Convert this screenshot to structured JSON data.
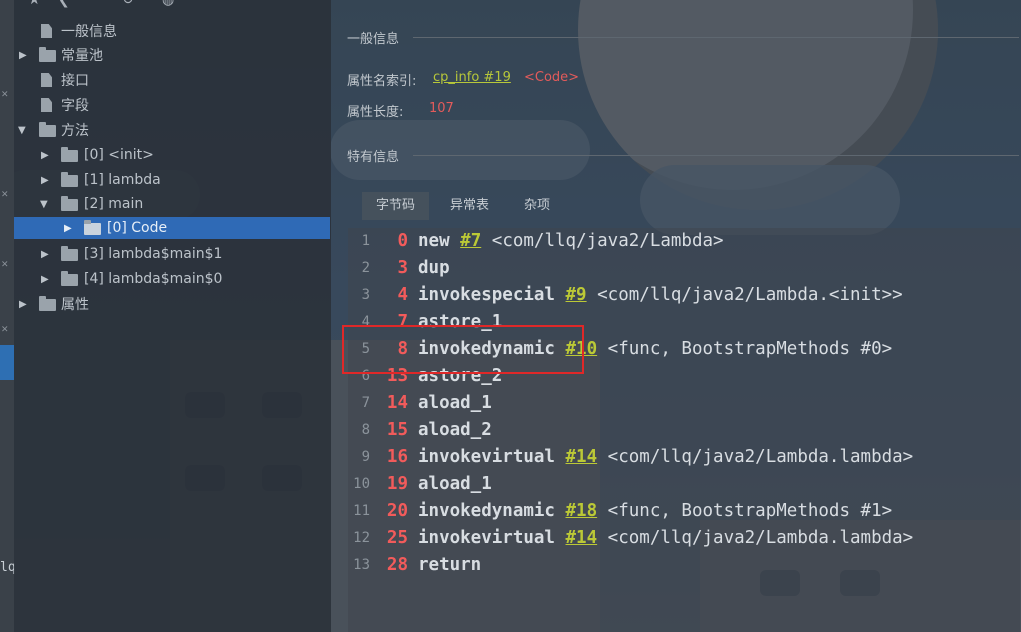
{
  "toolbar": {
    "icons": [
      "star-icon",
      "back-icon",
      "refresh-icon",
      "globe-icon"
    ]
  },
  "tree": {
    "items": [
      {
        "label": "一般信息",
        "icon": "file-icon",
        "arrow": ""
      },
      {
        "label": "常量池",
        "icon": "folder-icon",
        "arrow": "▶"
      },
      {
        "label": "接口",
        "icon": "file-icon",
        "arrow": ""
      },
      {
        "label": "字段",
        "icon": "file-icon",
        "arrow": ""
      },
      {
        "label": "方法",
        "icon": "folder-icon",
        "arrow": "▼"
      },
      {
        "label": "[0] <init>",
        "icon": "folder-icon",
        "arrow": "▶"
      },
      {
        "label": "[1] lambda",
        "icon": "folder-icon",
        "arrow": "▶"
      },
      {
        "label": "[2] main",
        "icon": "folder-icon",
        "arrow": "▼"
      },
      {
        "label": "[0] Code",
        "icon": "folder-icon",
        "arrow": "▶",
        "selected": true
      },
      {
        "label": "[3] lambda$main$1",
        "icon": "folder-icon",
        "arrow": "▶"
      },
      {
        "label": "[4] lambda$main$0",
        "icon": "folder-icon",
        "arrow": "▶"
      },
      {
        "label": "属性",
        "icon": "folder-icon",
        "arrow": "▶"
      }
    ]
  },
  "left_strip": {
    "label": "lq"
  },
  "info": {
    "general_title": "一般信息",
    "attr_name_index_label": "属性名索引:",
    "attr_name_index_link": "cp_info #19",
    "attr_name_index_value": "<Code>",
    "attr_length_label": "属性长度:",
    "attr_length_value": "107",
    "specific_title": "特有信息",
    "tabs": [
      {
        "label": "字节码",
        "active": true
      },
      {
        "label": "异常表",
        "active": false
      },
      {
        "label": "杂项",
        "active": false
      }
    ]
  },
  "bytecode": [
    {
      "line": "1",
      "offset": "0",
      "op": "new",
      "ref": "#7",
      "comment": "<com/llq/java2/Lambda>"
    },
    {
      "line": "2",
      "offset": "3",
      "op": "dup",
      "ref": "",
      "comment": ""
    },
    {
      "line": "3",
      "offset": "4",
      "op": "invokespecial",
      "ref": "#9",
      "comment": "<com/llq/java2/Lambda.<init>>"
    },
    {
      "line": "4",
      "offset": "7",
      "op": "astore_1",
      "ref": "",
      "comment": ""
    },
    {
      "line": "5",
      "offset": "8",
      "op": "invokedynamic",
      "ref": "#10",
      "comment": "<func, BootstrapMethods #0>"
    },
    {
      "line": "6",
      "offset": "13",
      "op": "astore_2",
      "ref": "",
      "comment": ""
    },
    {
      "line": "7",
      "offset": "14",
      "op": "aload_1",
      "ref": "",
      "comment": ""
    },
    {
      "line": "8",
      "offset": "15",
      "op": "aload_2",
      "ref": "",
      "comment": ""
    },
    {
      "line": "9",
      "offset": "16",
      "op": "invokevirtual",
      "ref": "#14",
      "comment": "<com/llq/java2/Lambda.lambda>"
    },
    {
      "line": "10",
      "offset": "19",
      "op": "aload_1",
      "ref": "",
      "comment": ""
    },
    {
      "line": "11",
      "offset": "20",
      "op": "invokedynamic",
      "ref": "#18",
      "comment": "<func, BootstrapMethods #1>"
    },
    {
      "line": "12",
      "offset": "25",
      "op": "invokevirtual",
      "ref": "#14",
      "comment": "<com/llq/java2/Lambda.lambda>"
    },
    {
      "line": "13",
      "offset": "28",
      "op": "return",
      "ref": "",
      "comment": ""
    }
  ],
  "colors": {
    "selection": "#2f6ab6",
    "offset": "#f25b5b",
    "link": "#b7c73a",
    "highlight_box": "#e02828"
  }
}
